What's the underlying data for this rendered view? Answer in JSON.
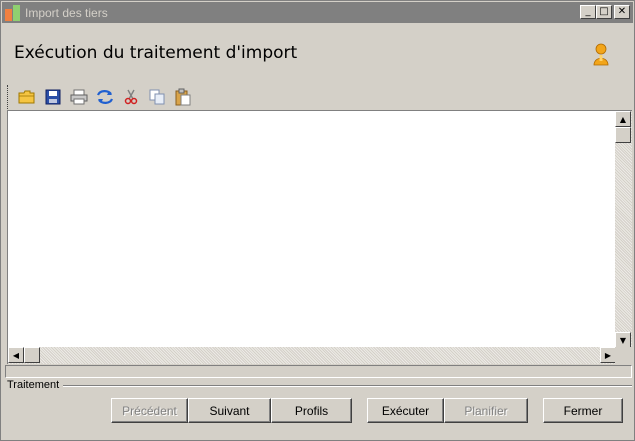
{
  "window": {
    "title": "Import des tiers",
    "controls": {
      "minimize": "_",
      "maximize": "□",
      "close": "✕"
    }
  },
  "header": {
    "title": "Exécution du traitement d'import",
    "user_icon": "user-icon"
  },
  "toolbar": {
    "items": [
      {
        "name": "open-folder-icon"
      },
      {
        "name": "save-icon"
      },
      {
        "name": "print-icon"
      },
      {
        "name": "refresh-icon"
      },
      {
        "name": "cut-icon"
      },
      {
        "name": "copy-icon"
      },
      {
        "name": "paste-icon"
      }
    ]
  },
  "editor": {
    "content": ""
  },
  "group": {
    "label": "Traitement"
  },
  "buttons": {
    "previous": "Précédent",
    "next": "Suivant",
    "profiles": "Profils",
    "execute": "Exécuter",
    "schedule": "Planifier",
    "close": "Fermer"
  },
  "colors": {
    "face": "#d4d0c8",
    "titlebar": "#808080",
    "disabled_text": "#808080",
    "editor_bg": "#ffffff"
  }
}
